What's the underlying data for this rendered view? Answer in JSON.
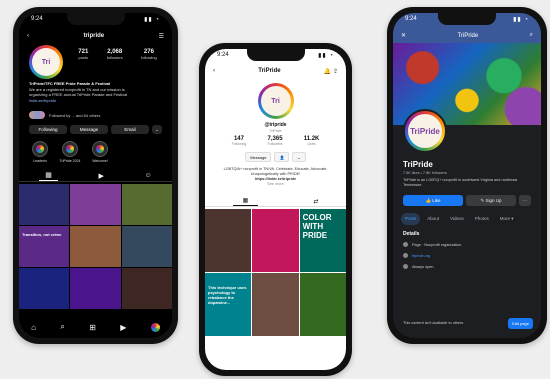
{
  "instagram": {
    "status_time": "9:24",
    "username": "tripride",
    "stats": [
      {
        "n": "721",
        "l": "posts"
      },
      {
        "n": "2,068",
        "l": "followers"
      },
      {
        "n": "276",
        "l": "following"
      }
    ],
    "bio_name": "TriPride/TFC FREE Pride Parade & Festival",
    "bio_lines": [
      "We are a registered nonprofit in TN and our mission is",
      "organizing a FREE annual TriPride Parade and Festival",
      "linktr.ee/tripride"
    ],
    "followed_by": "Followed by ... and 64 others",
    "buttons": {
      "following": "Following",
      "message": "Message",
      "email": "Email",
      "more": "⌄"
    },
    "highlights": [
      "Leaderin",
      "TriPride 2024",
      "Welcome!"
    ],
    "grid_posts": [
      {
        "text": "",
        "color": "#2b2b6e"
      },
      {
        "text": "",
        "color": "#7d3c98"
      },
      {
        "text": "",
        "color": "#556b2f"
      },
      {
        "text": "Transition, not crime",
        "color": "#5b2a86"
      },
      {
        "text": "",
        "color": "#8e5a3c"
      },
      {
        "text": "",
        "color": "#34495e"
      },
      {
        "text": "",
        "color": "#1a237e"
      },
      {
        "text": "",
        "color": "#4a148c"
      },
      {
        "text": "",
        "color": "#3e2723"
      }
    ]
  },
  "tiktok": {
    "status_time": "9:24",
    "username": "TriPride",
    "handle": "@tripride",
    "sub": "TriPride",
    "stats": [
      {
        "n": "147",
        "l": "Following"
      },
      {
        "n": "7,365",
        "l": "Followers"
      },
      {
        "n": "11.2K",
        "l": "Likes"
      }
    ],
    "btn_message": "Message",
    "bio": "LGBTQIA+ nonprofit in TN/VA. Celebrate, Educate, Advocate. Unapologetically with PRIDE!",
    "bio_link": "https://linktr.ee/tripride",
    "translate": "See more",
    "grid_posts": [
      {
        "big": "",
        "text": "",
        "color": "#4e342e"
      },
      {
        "big": "",
        "text": "",
        "color": "#c2185b"
      },
      {
        "big": "Color with Pride",
        "text": "",
        "color": "#00695c"
      },
      {
        "big": "",
        "text": "This technique uses psychology to rebalance the dopamine...",
        "color": "#00838f"
      },
      {
        "big": "",
        "text": "",
        "color": "#6d4c41"
      },
      {
        "big": "",
        "text": "",
        "color": "#33691e"
      }
    ]
  },
  "facebook": {
    "status_time": "9:24",
    "header_title": "TriPride",
    "page_name": "TriPride",
    "meta": "7.5K likes • 7.8K followers",
    "description": "TriPride is an LGBTQ+ nonprofit in southwest Virginia and northeast Tennessee.",
    "btn_like": "Like",
    "btn_signup": "Sign Up",
    "tabs": [
      "Posts",
      "About",
      "Videos",
      "Photos",
      "More ▾"
    ],
    "details_title": "Details",
    "details": [
      "Page · Nonprofit organization",
      "tripride.org",
      "Always open"
    ],
    "bottom_msg": "This content isn't available to others",
    "bottom_btn": "Edit page"
  }
}
